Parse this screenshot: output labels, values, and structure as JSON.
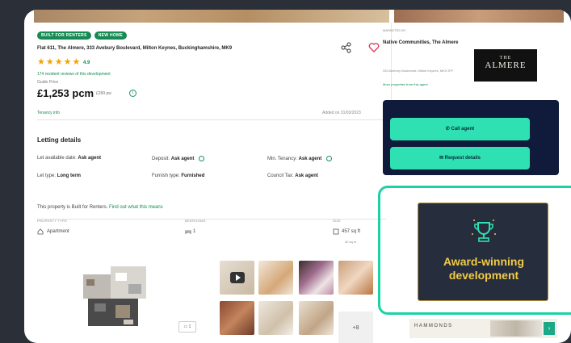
{
  "listing": {
    "badges": [
      "BUILT FOR RENTERS",
      "NEW HOME"
    ],
    "address": "Flat 611, The Almere, 333 Avebury Boulevard, Milton Keynes, Buckinghamshire, MK9",
    "rating": "4.9",
    "reviews_link": "174 resident reviews of this development",
    "guide_price_label": "Guide Price",
    "price": "£1,253 pcm",
    "price_pw": "£289 pw",
    "tenancy_info": "Tenancy info",
    "added_on": "Added on 31/03/2023",
    "letting_title": "Letting details",
    "details": {
      "let_available_label": "Let available date:",
      "let_available_value": "Ask agent",
      "deposit_label": "Deposit:",
      "deposit_value": "Ask agent",
      "min_tenancy_label": "Min. Tenancy:",
      "min_tenancy_value": "Ask agent",
      "let_type_label": "Let type:",
      "let_type_value": "Long term",
      "furnish_label": "Furnish type:",
      "furnish_value": "Furnished",
      "council_tax_label": "Council Tax:",
      "council_tax_value": "Ask agent"
    },
    "built_note": "This property is Built for Renters.",
    "built_link": "Find out what this means",
    "key_features": {
      "property_type_label": "PROPERTY TYPE",
      "property_type_value": "Apartment",
      "bedrooms_label": "BEDROOMS",
      "bedrooms_value": "1",
      "size_label": "SIZE",
      "size_value": "457 sq ft",
      "size_sub": "42 sq m"
    },
    "floorplan_button": "1",
    "more_photos": "+8"
  },
  "agent": {
    "marketed_by": "MARKETED BY",
    "name": "Native Communities, The Almere",
    "address": "333 Avebury Boulevard, Milton Keynes, MK9 2FF",
    "more_link": "More properties from this agent",
    "logo_top": "THE",
    "logo_bottom": "ALMERE",
    "call_button": "Call agent",
    "request_button": "Request details"
  },
  "award": {
    "line1": "Award-winning",
    "line2": "development"
  },
  "ad": {
    "brand": "HAMMONDS",
    "arrow": "›"
  },
  "colors": {
    "accent": "#2fe0b3",
    "highlight": "#1ad3a2",
    "badge": "#158a52",
    "award_text": "#f2cc47",
    "contact_bg": "#101a3a"
  }
}
